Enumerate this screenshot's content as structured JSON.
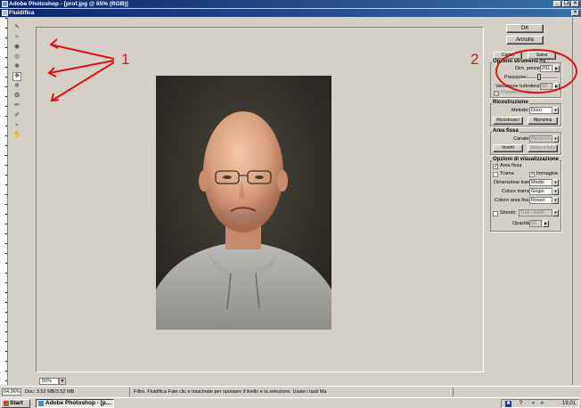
{
  "photoshop": {
    "title": "Adobe Photoshop - [prof.jpg @ 65% (RGB)]",
    "min_label": "_",
    "restore_label": "❐",
    "close_label": "×"
  },
  "dialog": {
    "title": "Fluidifica",
    "close_label": "×"
  },
  "tools": [
    {
      "name": "warp-tool-icon",
      "glyph": "✎"
    },
    {
      "name": "reconstruct-tool-icon",
      "glyph": "≈"
    },
    {
      "name": "twirl-cw-tool-icon",
      "glyph": "◉"
    },
    {
      "name": "twirl-ccw-tool-icon",
      "glyph": "◎"
    },
    {
      "name": "pucker-tool-icon",
      "glyph": "❀"
    },
    {
      "name": "bloat-tool-icon",
      "glyph": "❖"
    },
    {
      "name": "shift-pixels-tool-icon",
      "glyph": "✵"
    },
    {
      "name": "reflection-tool-icon",
      "glyph": "❂"
    },
    {
      "name": "freeze-tool-icon",
      "glyph": "✏"
    },
    {
      "name": "thaw-tool-icon",
      "glyph": "✐"
    },
    {
      "name": "zoom-tool-icon",
      "glyph": "⌕"
    },
    {
      "name": "hand-tool-icon",
      "glyph": "✋"
    }
  ],
  "buttons": {
    "ok": "OK",
    "cancel": "Annulla",
    "load_mesh": "Carica trama...",
    "save_mesh": "Salva trama..."
  },
  "tool_options": {
    "title": "Opzioni strumenti",
    "brush_size_label": "Dim. pennello:",
    "brush_size_value": "291",
    "pressure_label": "Pressione:",
    "pressure_value": "50",
    "turbulence_label": "Variazione turbolenza:",
    "turbulence_value": "50",
    "stylus_label": "Pressione stilo"
  },
  "reconstruction": {
    "title": "Ricostruzione",
    "mode_label": "Metodo:",
    "mode_value": "Duro",
    "reconstruct_btn": "Ricostruisci",
    "revert_btn": "Ripristina"
  },
  "freeze": {
    "title": "Area fissa",
    "channel_label": "Canale:",
    "channel_value": "Nessuno",
    "invert_btn": "Inverti",
    "thaw_all_btn": "Sblocca tutto"
  },
  "view": {
    "title": "Opzioni di visualizzazione",
    "frozen_label": "Area fissa",
    "mesh_label": "Trama",
    "image_label": "Immagine",
    "mesh_size_label": "Dimensione trama:",
    "mesh_size_value": "Medio",
    "mesh_color_label": "Colore trama:",
    "mesh_color_value": "Grigio",
    "freeze_color_label": "Colore area fissa:",
    "freeze_color_value": "Rosso",
    "backdrop_label": "Sfondo:",
    "backdrop_value": "Tutti i livelli",
    "opacity_label": "Opacità:",
    "opacity_value": "50"
  },
  "zoom": {
    "value": "50%"
  },
  "status": {
    "zoom": "64.96%",
    "doc": "Doc: 3.52 MB/3.52 MB",
    "hint": "Filtro. Fluidifica   Fate clic e trascinate per spostare il livello e la selezione. Usate i tasti Ma"
  },
  "taskbar": {
    "start": "Start",
    "task": "Adobe Photoshop - [p...",
    "clock": "19.01"
  },
  "annotations": {
    "label_1": "1",
    "label_2": "2",
    "color": "#e01010"
  }
}
